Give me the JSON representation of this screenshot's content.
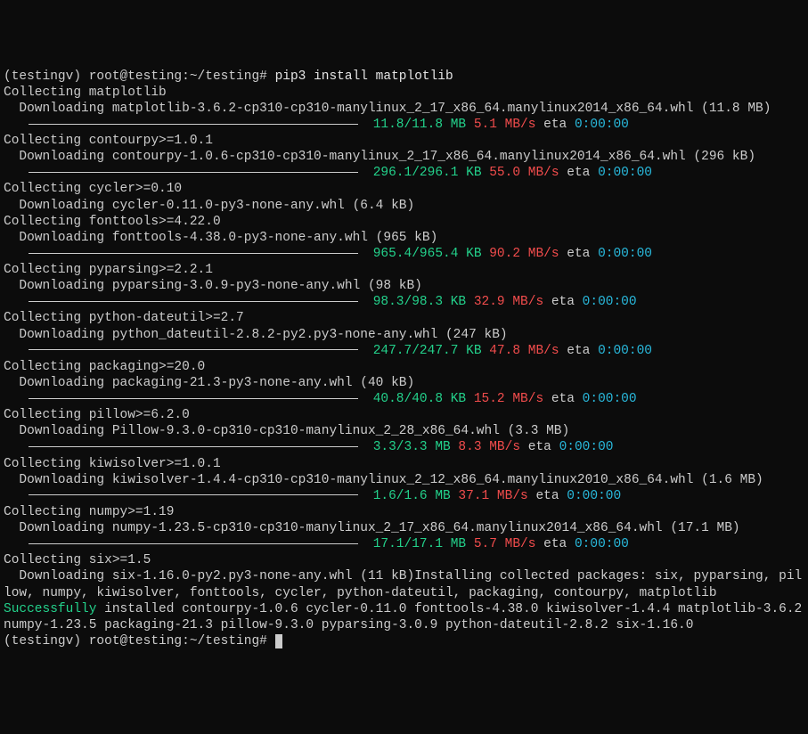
{
  "prompt1": {
    "venv": "(testingv) ",
    "userhost": "root@testing",
    "path": ":~/testing# ",
    "cmd": "pip3 install matplotlib"
  },
  "packages": [
    {
      "collect": "Collecting matplotlib",
      "download": "  Downloading matplotlib-3.6.2-cp310-cp310-manylinux_2_17_x86_64.manylinux2014_x86_64.whl (11.8 MB)",
      "progress": {
        "size": "11.8/11.8 MB",
        "speed": "5.1 MB/s",
        "eta_label": "eta",
        "eta": "0:00:00"
      }
    },
    {
      "collect": "Collecting contourpy>=1.0.1",
      "download": "  Downloading contourpy-1.0.6-cp310-cp310-manylinux_2_17_x86_64.manylinux2014_x86_64.whl (296 kB)",
      "progress": {
        "size": "296.1/296.1 KB",
        "speed": "55.0 MB/s",
        "eta_label": "eta",
        "eta": "0:00:00"
      }
    },
    {
      "collect": "Collecting cycler>=0.10",
      "download": "  Downloading cycler-0.11.0-py3-none-any.whl (6.4 kB)"
    },
    {
      "collect": "Collecting fonttools>=4.22.0",
      "download": "  Downloading fonttools-4.38.0-py3-none-any.whl (965 kB)",
      "progress": {
        "size": "965.4/965.4 KB",
        "speed": "90.2 MB/s",
        "eta_label": "eta",
        "eta": "0:00:00"
      }
    },
    {
      "collect": "Collecting pyparsing>=2.2.1",
      "download": "  Downloading pyparsing-3.0.9-py3-none-any.whl (98 kB)",
      "progress": {
        "size": "98.3/98.3 KB",
        "speed": "32.9 MB/s",
        "eta_label": "eta",
        "eta": "0:00:00"
      }
    },
    {
      "collect": "Collecting python-dateutil>=2.7",
      "download": "  Downloading python_dateutil-2.8.2-py2.py3-none-any.whl (247 kB)",
      "progress": {
        "size": "247.7/247.7 KB",
        "speed": "47.8 MB/s",
        "eta_label": "eta",
        "eta": "0:00:00"
      }
    },
    {
      "collect": "Collecting packaging>=20.0",
      "download": "  Downloading packaging-21.3-py3-none-any.whl (40 kB)",
      "progress": {
        "size": "40.8/40.8 KB",
        "speed": "15.2 MB/s",
        "eta_label": "eta",
        "eta": "0:00:00"
      }
    },
    {
      "collect": "Collecting pillow>=6.2.0",
      "download": "  Downloading Pillow-9.3.0-cp310-cp310-manylinux_2_28_x86_64.whl (3.3 MB)",
      "progress": {
        "size": "3.3/3.3 MB",
        "speed": "8.3 MB/s",
        "eta_label": "eta",
        "eta": "0:00:00"
      }
    },
    {
      "collect": "Collecting kiwisolver>=1.0.1",
      "download": "  Downloading kiwisolver-1.4.4-cp310-cp310-manylinux_2_12_x86_64.manylinux2010_x86_64.whl (1.6 MB)",
      "progress": {
        "size": "1.6/1.6 MB",
        "speed": "37.1 MB/s",
        "eta_label": "eta",
        "eta": "0:00:00"
      }
    },
    {
      "collect": "Collecting numpy>=1.19",
      "download": "  Downloading numpy-1.23.5-cp310-cp310-manylinux_2_17_x86_64.manylinux2014_x86_64.whl (17.1 MB)",
      "progress": {
        "size": "17.1/17.1 MB",
        "speed": "5.7 MB/s",
        "eta_label": "eta",
        "eta": "0:00:00"
      }
    },
    {
      "collect": "Collecting six>=1.5",
      "download": "  Downloading six-1.16.0-py2.py3-none-any.whl (11 kB)"
    }
  ],
  "installing": "Installing collected packages: six, pyparsing, pillow, numpy, kiwisolver, fonttools, cycler, python-dateutil, packaging, contourpy, matplotlib",
  "success_prefix": "Successfully",
  "success_rest": " installed contourpy-1.0.6 cycler-0.11.0 fonttools-4.38.0 kiwisolver-1.4.4 matplotlib-3.6.2 numpy-1.23.5 packaging-21.3 pillow-9.3.0 pyparsing-3.0.9 python-dateutil-2.8.2 six-1.16.0",
  "prompt2": {
    "venv": "(testingv) ",
    "userhost": "root@testing",
    "path": ":~/testing# "
  }
}
